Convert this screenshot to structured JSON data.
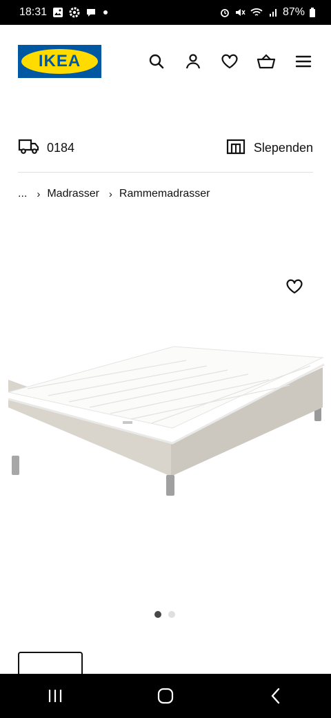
{
  "status_bar": {
    "time": "18:31",
    "left_icons": [
      "gallery-icon",
      "settings-icon",
      "chat-icon",
      "dot-icon"
    ],
    "right_icons": [
      "alarm-icon",
      "mute-icon",
      "wifi-call-icon",
      "signal-icon"
    ],
    "battery": "87%"
  },
  "header": {
    "logo_text": "IKEA",
    "icons": [
      "search-icon",
      "account-icon",
      "wishlist-icon",
      "basket-icon",
      "menu-icon"
    ]
  },
  "location": {
    "postcode": "0184",
    "store": "Slependen"
  },
  "breadcrumb": {
    "ellipsis": "...",
    "items": [
      "Madrasser",
      "Rammemadrasser"
    ]
  },
  "gallery": {
    "image": "bed-frame-mattress-image",
    "total": 2,
    "active_index": 0
  },
  "colors": {
    "brand_blue": "#0058a3",
    "brand_yellow": "#ffdb00"
  }
}
